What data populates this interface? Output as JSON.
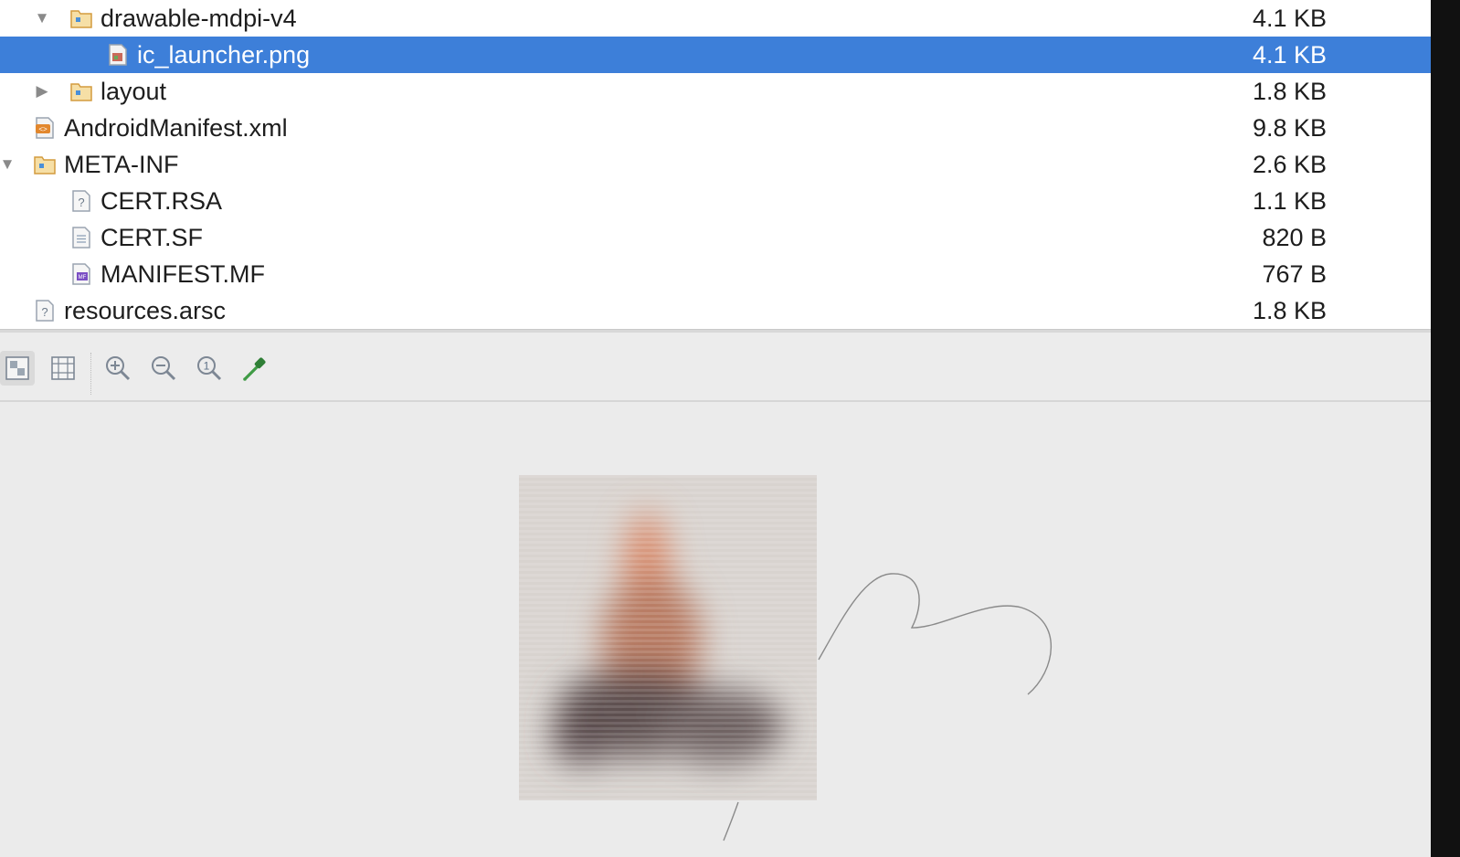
{
  "tree": {
    "rows": [
      {
        "name": "drawable-mdpi-v4",
        "size": "4.1 KB",
        "icon": "folder-icon",
        "expander": "expanded"
      },
      {
        "name": "ic_launcher.png",
        "size": "4.1 KB",
        "icon": "image-file-icon",
        "selected": true
      },
      {
        "name": "layout",
        "size": "1.8 KB",
        "icon": "folder-icon",
        "expander": "collapsed"
      },
      {
        "name": "AndroidManifest.xml",
        "size": "9.8 KB",
        "icon": "xml-file-icon"
      },
      {
        "name": "META-INF",
        "size": "2.6 KB",
        "icon": "folder-icon",
        "expander": "expanded"
      },
      {
        "name": "CERT.RSA",
        "size": "1.1 KB",
        "icon": "unknown-file-icon"
      },
      {
        "name": "CERT.SF",
        "size": "820 B",
        "icon": "text-file-icon"
      },
      {
        "name": "MANIFEST.MF",
        "size": "767 B",
        "icon": "manifest-file-icon"
      },
      {
        "name": "resources.arsc",
        "size": "1.8 KB",
        "icon": "unknown-file-icon"
      }
    ]
  },
  "toolbar": {
    "buttons": [
      {
        "icon": "chessboard-background-icon",
        "active": true
      },
      {
        "icon": "grid-icon"
      },
      {
        "icon": "zoom-in-icon"
      },
      {
        "icon": "zoom-out-icon"
      },
      {
        "icon": "actual-size-icon"
      },
      {
        "icon": "color-picker-icon"
      }
    ]
  },
  "colors": {
    "selection": "#3d7fd9",
    "folder": "#e8b04e",
    "panel": "#ececec"
  }
}
